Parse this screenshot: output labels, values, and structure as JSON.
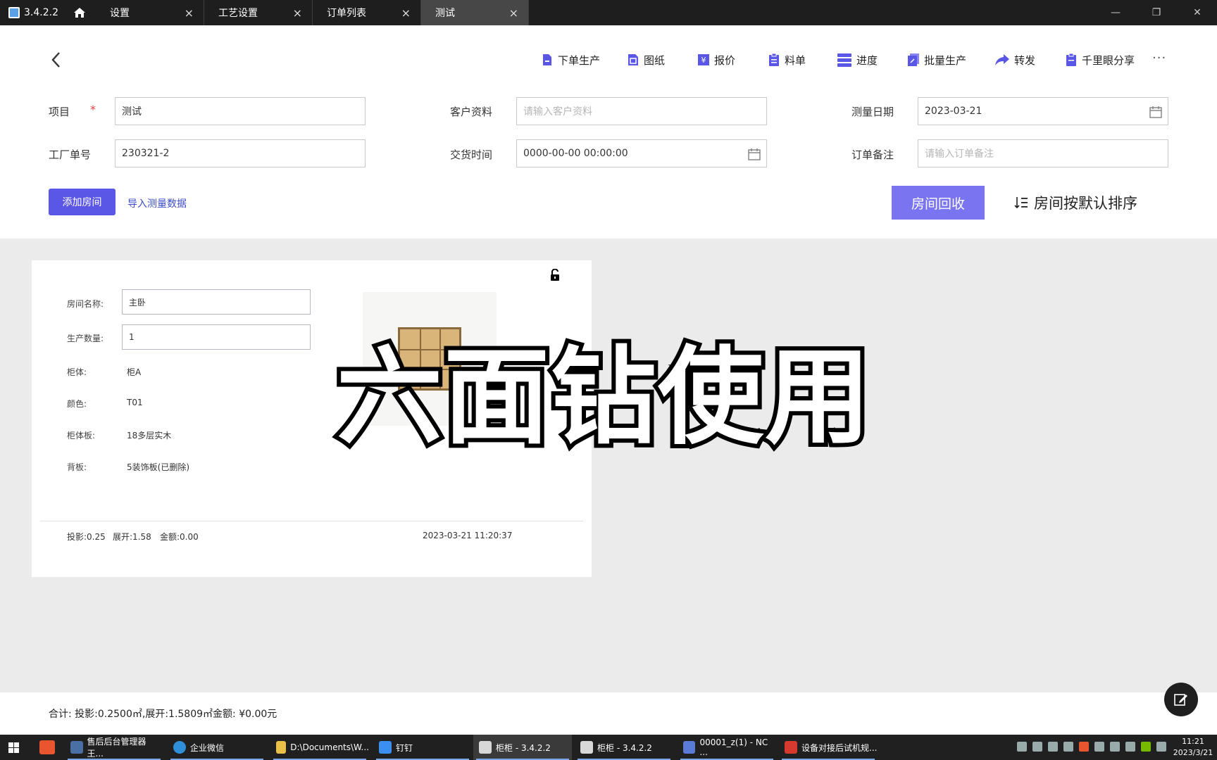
{
  "titlebar": {
    "version": "3.4.2.2",
    "tabs": [
      {
        "label": "设置"
      },
      {
        "label": "工艺设置"
      },
      {
        "label": "订单列表"
      },
      {
        "label": "测试"
      }
    ],
    "close_glyph": "×",
    "controls": {
      "minimize": "—",
      "restore": "❐",
      "close": "✕"
    }
  },
  "toolbar": {
    "items": [
      {
        "label": "下单生产",
        "icon": "order-production-icon"
      },
      {
        "label": "图纸",
        "icon": "drawing-icon"
      },
      {
        "label": "报价",
        "icon": "quote-icon"
      },
      {
        "label": "料单",
        "icon": "material-list-icon"
      },
      {
        "label": "进度",
        "icon": "progress-icon"
      },
      {
        "label": "批量生产",
        "icon": "batch-production-icon"
      },
      {
        "label": "转发",
        "icon": "forward-icon"
      },
      {
        "label": "千里眼分享",
        "icon": "share-icon"
      }
    ],
    "more": "···"
  },
  "form": {
    "project_label": "项目",
    "required_mark": "*",
    "project_value": "测试",
    "customer_label": "客户资料",
    "customer_placeholder": "请输入客户资料",
    "measure_date_label": "测量日期",
    "measure_date_value": "2023-03-21",
    "factory_no_label": "工厂单号",
    "factory_no_value": "230321-2",
    "delivery_label": "交货时间",
    "delivery_value": "0000-00-00 00:00:00",
    "remark_label": "订单备注",
    "remark_placeholder": "请输入订单备注"
  },
  "actions": {
    "add_room": "添加房间",
    "import_measure": "导入测量数据",
    "room_recycle": "房间回收",
    "sort": "房间按默认排序"
  },
  "room_card": {
    "room_name_label": "房间名称:",
    "room_name_value": "主卧",
    "qty_label": "生产数量:",
    "qty_value": "1",
    "cabinet_label": "柜体:",
    "cabinet_value": "柜A",
    "color_label": "颜色:",
    "color_value": "T01",
    "board_label": "柜体板:",
    "board_value": "18多层实木",
    "back_label": "背板:",
    "back_value": "5装饰板(已删除)",
    "projection": "投影:0.25",
    "unfold": "展开:1.58",
    "amount": "金额:0.00",
    "timestamp": "2023-03-21 11:20:37"
  },
  "overlay_caption": "六面钻使用",
  "summary": "合计: 投影:0.2500㎡,展开:1.5809㎡金额: ¥0.00元",
  "taskbar": {
    "items": [
      {
        "label": "售后后台管理器 王..."
      },
      {
        "label": "企业微信"
      },
      {
        "label": "D:\\Documents\\W..."
      },
      {
        "label": "钉钉"
      },
      {
        "label": "柜柜 - 3.4.2.2"
      },
      {
        "label": "柜柜 - 3.4.2.2"
      },
      {
        "label": "00001_z(1) - NC ..."
      },
      {
        "label": "设备对接后试机规..."
      }
    ],
    "time": "11:21",
    "date": "2023/3/21"
  },
  "colors": {
    "primary": "#5b57e6",
    "recycle": "#7b74f0",
    "link": "#3d4cc9",
    "required": "#e53e3e",
    "toolbar_icon": "#5b57e6"
  }
}
